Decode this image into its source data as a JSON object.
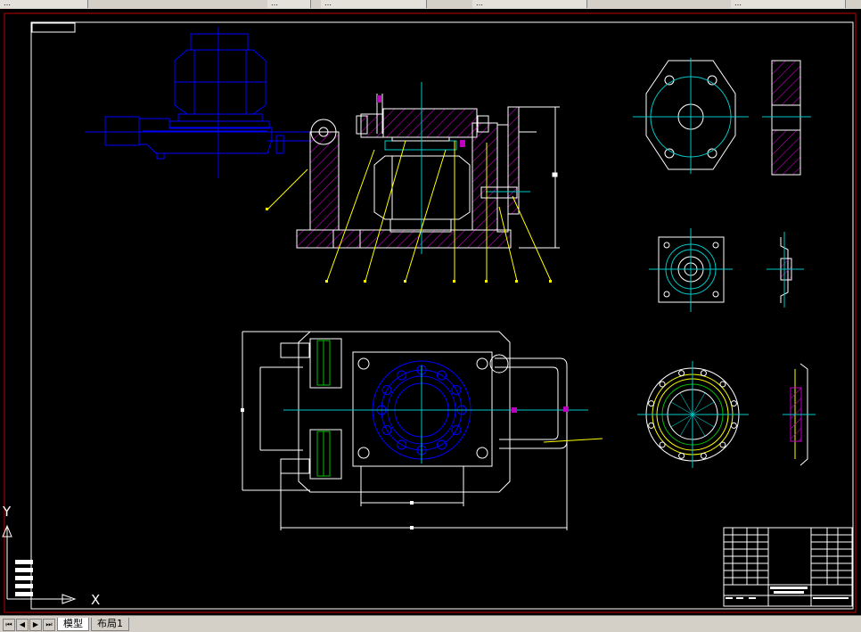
{
  "toolbar": {
    "tabs": [
      "…",
      "…",
      "…",
      "…",
      "…"
    ]
  },
  "ucs": {
    "x_label": "X",
    "y_label": "Y"
  },
  "layout_tabs": {
    "model": "模型",
    "layout1": "布局1"
  },
  "colors": {
    "background": "#000000",
    "frame": "#ffffff",
    "outer_border": "#c00000",
    "blue_parts": "#0000ff",
    "hatch": "#c000c0",
    "centerline": "#00c8c8",
    "leader": "#ffff00",
    "green": "#00c000"
  }
}
